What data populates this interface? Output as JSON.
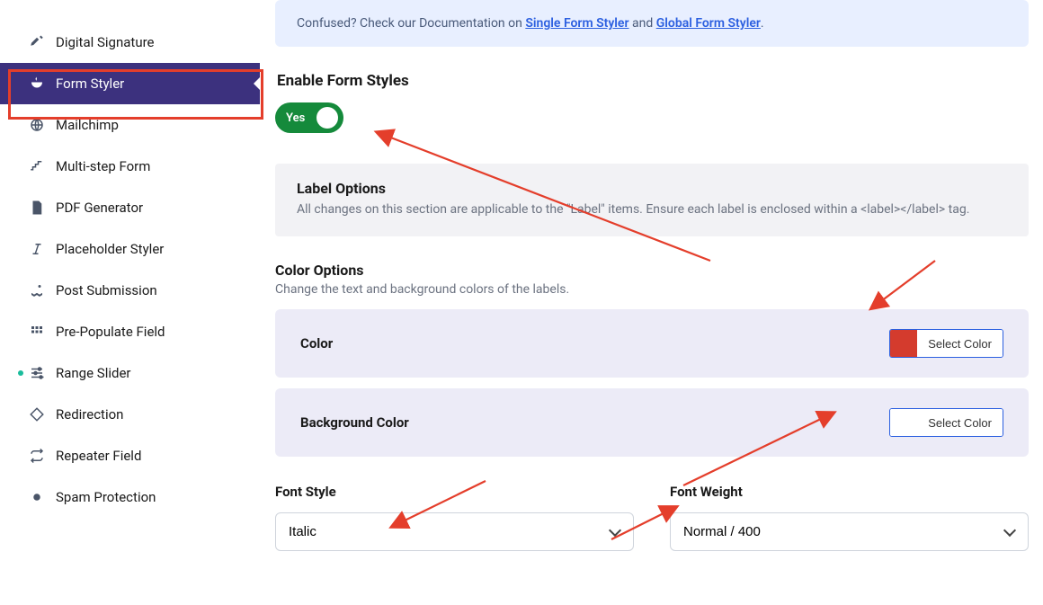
{
  "sidebar": {
    "items": [
      {
        "label": "Digital Signature"
      },
      {
        "label": "Form Styler"
      },
      {
        "label": "Mailchimp"
      },
      {
        "label": "Multi-step Form"
      },
      {
        "label": "PDF Generator"
      },
      {
        "label": "Placeholder Styler"
      },
      {
        "label": "Post Submission"
      },
      {
        "label": "Pre-Populate Field"
      },
      {
        "label": "Range Slider"
      },
      {
        "label": "Redirection"
      },
      {
        "label": "Repeater Field"
      },
      {
        "label": "Spam Protection"
      }
    ]
  },
  "info": {
    "prefix": "Confused? Check our Documentation on ",
    "link1": "Single Form Styler",
    "mid": " and ",
    "link2": "Global Form Styler",
    "suffix": "."
  },
  "enable": {
    "title": "Enable Form Styles",
    "toggle": "Yes"
  },
  "labelOptions": {
    "title": "Label Options",
    "desc": "All changes on this section are applicable to the \"Label\" items. Ensure each label is enclosed within a <label></label> tag."
  },
  "colorOptions": {
    "title": "Color Options",
    "desc": "Change the text and background colors of the labels.",
    "rows": [
      {
        "label": "Color",
        "swatch": "#d43b2d",
        "button": "Select Color"
      },
      {
        "label": "Background Color",
        "swatch": "",
        "button": "Select Color"
      }
    ]
  },
  "fontStyle": {
    "label": "Font Style",
    "value": "Italic"
  },
  "fontWeight": {
    "label": "Font Weight",
    "value": "Normal / 400"
  }
}
